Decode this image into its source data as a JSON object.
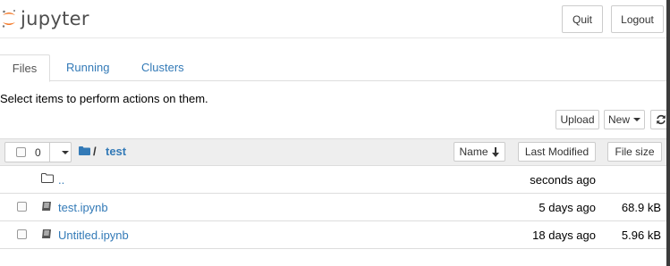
{
  "header": {
    "brand": "jupyter",
    "quit_label": "Quit",
    "logout_label": "Logout",
    "accent_color": "#f37726"
  },
  "tabs": [
    {
      "label": "Files",
      "active": true
    },
    {
      "label": "Running",
      "active": false
    },
    {
      "label": "Clusters",
      "active": false
    }
  ],
  "toolbar": {
    "instruction": "Select items to perform actions on them.",
    "upload_label": "Upload",
    "new_label": "New",
    "refresh_icon": "refresh-icon"
  },
  "list_header": {
    "selected_count": "0",
    "breadcrumb_sep": "/",
    "breadcrumb_current": "test",
    "col_name": "Name",
    "col_modified": "Last Modified",
    "col_size": "File size"
  },
  "rows": [
    {
      "name": "..",
      "type": "folder",
      "modified": "seconds ago",
      "size": ""
    },
    {
      "name": "test.ipynb",
      "type": "notebook",
      "modified": "5 days ago",
      "size": "68.9 kB"
    },
    {
      "name": "Untitled.ipynb",
      "type": "notebook",
      "modified": "18 days ago",
      "size": "5.96 kB"
    }
  ]
}
